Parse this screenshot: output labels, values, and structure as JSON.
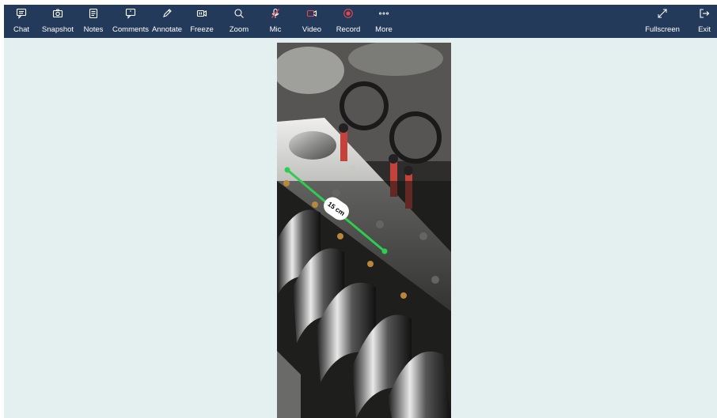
{
  "toolbar": {
    "chat": "Chat",
    "snapshot": "Snapshot",
    "notes": "Notes",
    "comments": "Comments",
    "annotate": "Annotate",
    "freeze": "Freeze",
    "zoom": "Zoom",
    "mic": "Mic",
    "video": "Video",
    "record": "Record",
    "more": "More",
    "fullscreen": "Fullscreen",
    "exit": "Exit"
  },
  "colors": {
    "toolbar_bg": "#243a5a",
    "stage_bg": "#e4efef",
    "alert_red": "#e8454d",
    "measure_green": "#2ecc4f"
  },
  "measurement": {
    "label": "15 cm"
  }
}
